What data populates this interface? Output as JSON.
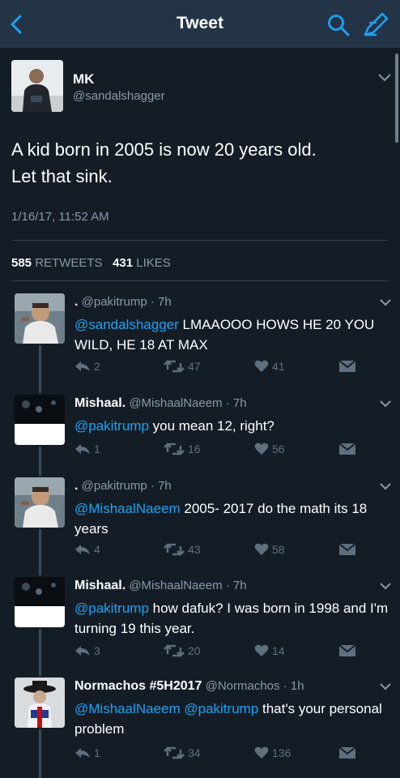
{
  "nav": {
    "title": "Tweet"
  },
  "main_tweet": {
    "name": "MK",
    "handle": "@sandalshagger",
    "text_line1": "A kid born in 2005 is now 20 years old.",
    "text_line2": "Let that sink.",
    "timestamp": "1/16/17, 11:52 AM",
    "retweets_count": "585",
    "retweets_label": "RETWEETS",
    "likes_count": "431",
    "likes_label": "LIKES"
  },
  "replies": [
    {
      "name": ".",
      "handle": "@pakitrump",
      "time": "· 7h",
      "mention": "@sandalshagger",
      "text": " LMAAOOO HOWS HE 20 YOU WILD, HE 18 AT MAX",
      "reply_count": "2",
      "retweet_count": "47",
      "like_count": "41"
    },
    {
      "name": "Mishaal.",
      "handle": "@MishaalNaeem",
      "time": "· 7h",
      "mention": "@pakitrump",
      "text": " you mean 12, right?",
      "reply_count": "1",
      "retweet_count": "16",
      "like_count": "56"
    },
    {
      "name": ".",
      "handle": "@pakitrump",
      "time": "· 7h",
      "mention": "@MishaalNaeem",
      "text": " 2005- 2017 do the math its 18 years",
      "reply_count": "4",
      "retweet_count": "43",
      "like_count": "58"
    },
    {
      "name": "Mishaal.",
      "handle": "@MishaalNaeem",
      "time": "· 7h",
      "mention": "@pakitrump",
      "text": " how dafuk? I was born in 1998 and I'm turning 19 this year.",
      "reply_count": "3",
      "retweet_count": "20",
      "like_count": "14"
    },
    {
      "name": "Normachos #5H2017",
      "handle": "@Normachos",
      "time": "· 1h",
      "mention": "@MishaalNaeem @pakitrump",
      "text": " that's your personal problem",
      "reply_count": "1",
      "retweet_count": "34",
      "like_count": "136"
    }
  ],
  "colors": {
    "background": "#141d26",
    "navbar": "#243447",
    "link": "#1da1f2",
    "secondary_text": "#8899a6"
  },
  "icons": [
    "back-chevron-icon",
    "search-icon",
    "compose-icon",
    "chevron-down-icon",
    "reply-icon",
    "retweet-icon",
    "heart-icon",
    "dm-icon"
  ]
}
